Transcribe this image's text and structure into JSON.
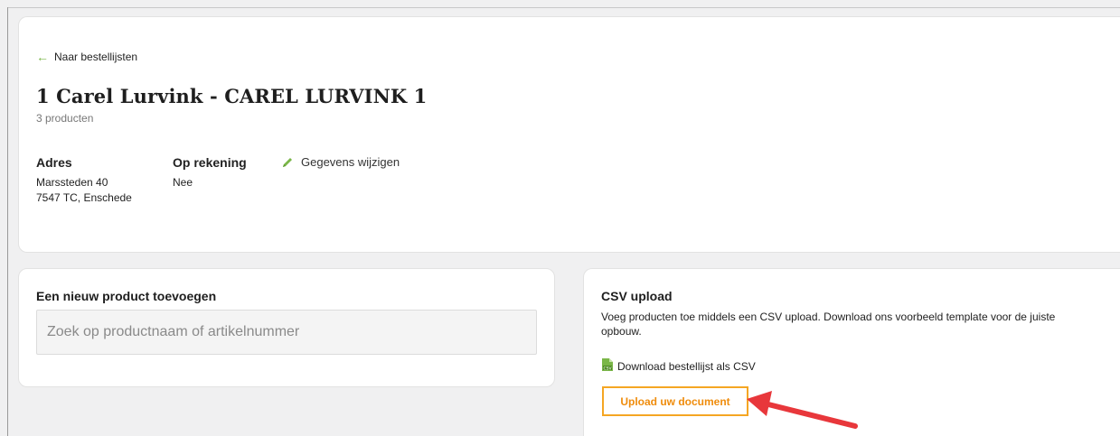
{
  "back_link": {
    "label": "Naar bestellijsten",
    "icon": "arrow-left-icon"
  },
  "header": {
    "title": "1 Carel Lurvink - CAREL LURVINK 1",
    "subtitle": "3 producten"
  },
  "details": {
    "address_label": "Adres",
    "address_line1": "Marssteden 40",
    "address_line2": "7547 TC, Enschede",
    "account_label": "Op rekening",
    "account_value": "Nee",
    "edit_label": "Gegevens wijzigen",
    "edit_icon": "pencil-icon"
  },
  "add_product": {
    "title": "Een nieuw product toevoegen",
    "search_placeholder": "Zoek op productnaam of artikelnummer",
    "search_value": ""
  },
  "csv": {
    "title": "CSV upload",
    "description": "Voeg producten toe middels een CSV upload. Download ons voorbeeld template voor de juiste opbouw.",
    "download_label": "Download bestellijst als CSV",
    "download_icon": "csv-file-icon",
    "upload_label": "Upload uw document"
  },
  "colors": {
    "accent_green": "#7ab648",
    "accent_orange": "#f5a623",
    "annotation_red": "#e8373b"
  }
}
